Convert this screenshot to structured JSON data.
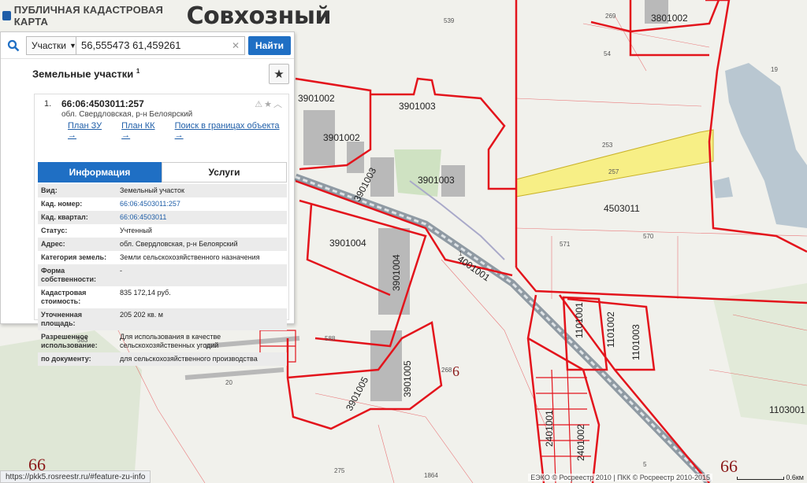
{
  "header": {
    "app_title": "ПУБЛИЧНАЯ КАДАСТРОВАЯ КАРТА",
    "place_name": "Совхозный"
  },
  "search": {
    "type_label": "Участки",
    "query": "56,555473 61,459261",
    "find_label": "Найти"
  },
  "panel": {
    "title": "Земельные участки",
    "title_sup": "1",
    "item": {
      "number": "1.",
      "cad_number": "66:06:4503011:257",
      "address": "обл. Свердловская, р-н Белоярский",
      "links": [
        "План ЗУ →",
        "План КК →",
        "Поиск в границах объекта →"
      ]
    },
    "tabs": [
      "Информация",
      "Услуги"
    ],
    "rows": [
      {
        "k": "Вид:",
        "v": "Земельный участок"
      },
      {
        "k": "Кад. номер:",
        "v": "66:06:4503011:257"
      },
      {
        "k": "Кад. квартал:",
        "v": "66:06:4503011"
      },
      {
        "k": "Статус:",
        "v": "Учтенный"
      },
      {
        "k": "Адрес:",
        "v": "обл. Свердловская, р-н Белоярский"
      },
      {
        "k": "Категория земель:",
        "v": "Земли сельскохозяйственного назначения"
      },
      {
        "k": "Форма собственности:",
        "v": "-"
      },
      {
        "k": "Кадастровая стоимость:",
        "v": "835 172,14 руб."
      },
      {
        "k": "Уточненная площадь:",
        "v": "205 202 кв. м"
      },
      {
        "k": "Разрешенное использование:",
        "v": "Для использования в качестве сельскохозяйственных угодий"
      },
      {
        "k": "по документу:",
        "v": "для сельскохозяйственного производства"
      }
    ]
  },
  "map": {
    "labels": {
      "b3901002a": "3901002",
      "b3901002b": "3901002",
      "b3901003a": "3901003",
      "b3901003b": "3901003",
      "b3901003c": "3901003",
      "b3901004": "3901004",
      "b3901004v": "3901004",
      "b3901005": "3901005",
      "b3901005d": "3901005",
      "b4001001": "4001001",
      "b4503011": "4503011",
      "b3801002": "3801002",
      "b1101001": "1101001",
      "b1101002": "1101002",
      "b1101003": "1101003",
      "b2401001": "2401001",
      "b2401002": "2401002",
      "b1103001": "1103001",
      "p539": "539",
      "p269": "269",
      "p54": "54",
      "p19": "19",
      "p253": "253",
      "p257": "257",
      "p570": "570",
      "p571": "571",
      "p591": "591",
      "p583": "583",
      "p588": "588",
      "p268": "268",
      "p20": "20",
      "p275": "275",
      "p1864": "1864",
      "p5": "5",
      "p1": "1",
      "big6": "6",
      "big66a": "66",
      "big66b": "66"
    },
    "highlight_color": "#f7ef86",
    "boundary_color": "#e3141c",
    "water_color": "#b9c7d1"
  },
  "status_url": "https://pkk5.rosreestr.ru/#feature-zu-info",
  "attribution": "ЕЭКО © Росреестр 2010 | ПКК © Росреестр 2010-2015",
  "scale_label": "0.6км"
}
